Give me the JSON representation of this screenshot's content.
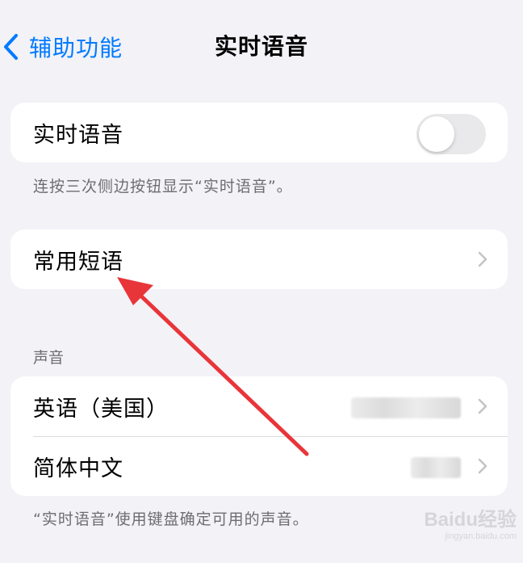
{
  "nav": {
    "back_label": "辅助功能",
    "title": "实时语音"
  },
  "live_speech": {
    "label": "实时语音",
    "toggle_on": false,
    "footnote": "连按三次侧边按钮显示“实时语音”。"
  },
  "phrases": {
    "label": "常用短语"
  },
  "voices": {
    "header": "声音",
    "items": [
      {
        "label": "英语（美国）"
      },
      {
        "label": "简体中文"
      }
    ],
    "footnote": "“实时语音”使用键盘确定可用的声音。"
  },
  "watermark": {
    "logo": "Baidu经验",
    "sub": "jingyan.baidu.com"
  },
  "colors": {
    "accent": "#007aff",
    "background": "#f2f2f7",
    "annotation_arrow": "#e8353a"
  }
}
